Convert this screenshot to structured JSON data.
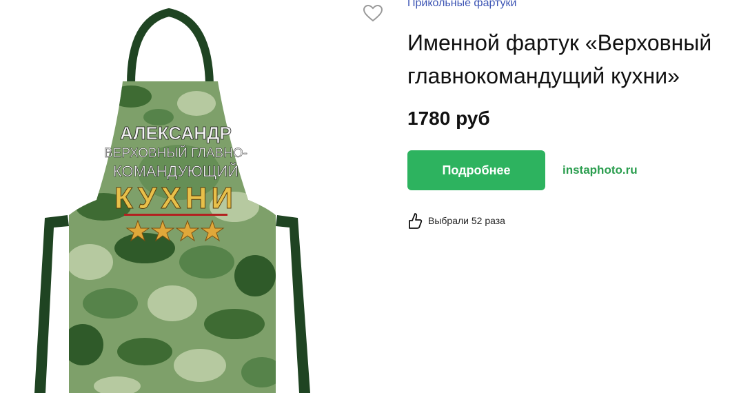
{
  "product": {
    "category": "Прикольные фартуки",
    "title": "Именной фартук «Верховный\nглавнокомандущий кухни»",
    "price": "1780 руб",
    "more_button": "Подробнее",
    "shop_link": "instaphoto.ru",
    "likes_text": "Выбрали 52 раза"
  },
  "apron_print": {
    "name": "АЛЕКСАНДР",
    "line1": "ВЕРХОВНЫЙ ГЛАВНО-",
    "line2": "КОМАНДУЮЩИЙ",
    "line3": "КУХНИ"
  },
  "icons": {
    "favorite": "heart-icon",
    "likes": "thumbs-up-icon"
  },
  "colors": {
    "button_green": "#2db35f",
    "link_green": "#2a9d4e",
    "category_blue": "#3c54b4",
    "strap_green": "#1f4422"
  }
}
